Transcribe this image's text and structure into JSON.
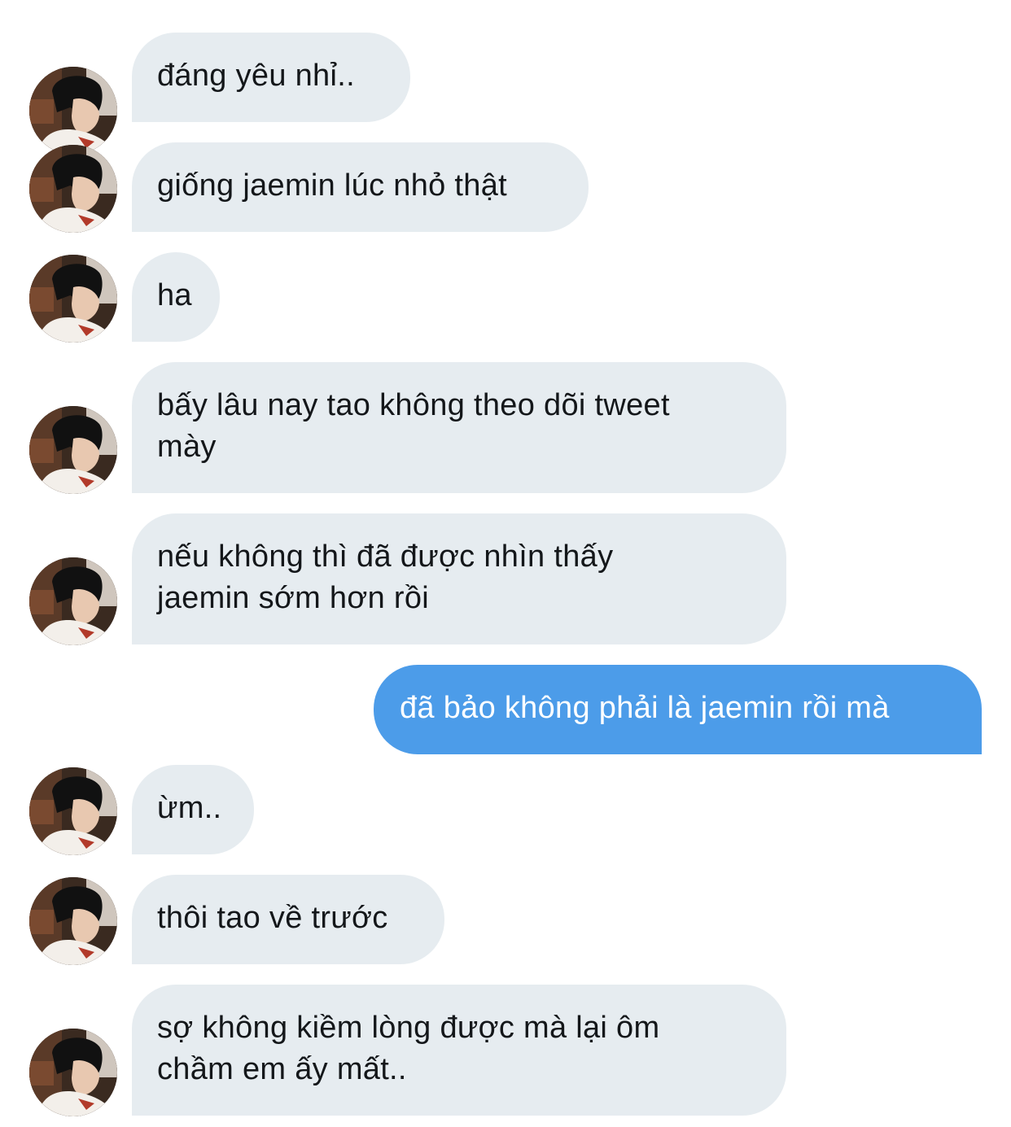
{
  "conversation": {
    "messages": [
      {
        "sender": "them",
        "text": "đáng yêu nhỉ.."
      },
      {
        "sender": "them",
        "text": "giống jaemin lúc nhỏ thật"
      },
      {
        "sender": "them",
        "text": "ha"
      },
      {
        "sender": "them",
        "text": "bấy lâu nay tao không theo dõi tweet\nmày"
      },
      {
        "sender": "them",
        "text": "nếu không thì đã được nhìn thấy\njaemin sớm hơn rồi"
      },
      {
        "sender": "me",
        "text": "đã bảo không phải là jaemin rồi mà"
      },
      {
        "sender": "them",
        "text": "ừm.."
      },
      {
        "sender": "them",
        "text": "thôi tao về trước"
      },
      {
        "sender": "them",
        "text": "sợ không kiềm lòng được mà lại ôm\nchầm em ấy mất.."
      }
    ]
  },
  "colors": {
    "incoming_bubble": "#e6ecf0",
    "outgoing_bubble": "#4c9ce9",
    "incoming_text": "#14171a",
    "outgoing_text": "#ffffff",
    "background": "#ffffff"
  },
  "icons": {
    "avatar": "profile-photo"
  }
}
